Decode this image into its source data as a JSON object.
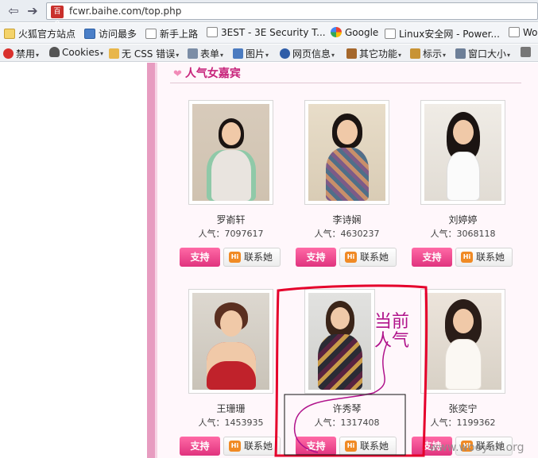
{
  "browser": {
    "url": "fcwr.baihe.com/top.php",
    "site_icon_text": "百合"
  },
  "bookmarks": [
    {
      "label": "火狐官方站点",
      "icon": "folder-icon"
    },
    {
      "label": "访问最多",
      "icon": "star-page-icon"
    },
    {
      "label": "新手上路",
      "icon": "page-icon"
    },
    {
      "label": "3EST - 3E Security T...",
      "icon": "page-icon"
    },
    {
      "label": "Google",
      "icon": "google-icon"
    },
    {
      "label": "Linux安全网 - Power...",
      "icon": "page-icon"
    },
    {
      "label": "Wo",
      "icon": "page-icon"
    }
  ],
  "devbar": [
    {
      "label": "禁用",
      "icon": "disable-icon"
    },
    {
      "label": "Cookies",
      "icon": "person-icon"
    },
    {
      "label": "无 CSS 错误",
      "icon": "pencil-icon"
    },
    {
      "label": "表单",
      "icon": "form-icon"
    },
    {
      "label": "图片",
      "icon": "image-icon"
    },
    {
      "label": "网页信息",
      "icon": "info-icon"
    },
    {
      "label": "其它功能",
      "icon": "toolbox-icon"
    },
    {
      "label": "标示",
      "icon": "marker-icon"
    },
    {
      "label": "窗口大小",
      "icon": "resize-icon"
    }
  ],
  "section": {
    "title": "人气女嘉宾"
  },
  "cards": [
    {
      "name": "罗嵛轩",
      "popularity": "人气：7097617"
    },
    {
      "name": "李诗娴",
      "popularity": "人气：4630237"
    },
    {
      "name": "刘婷婷",
      "popularity": "人气：3068118"
    },
    {
      "name": "王珊珊",
      "popularity": "人气：1453935"
    },
    {
      "name": "许秀琴",
      "popularity": "人气：1317408"
    },
    {
      "name": "张奕宁",
      "popularity": "人气：1199362"
    }
  ],
  "buttons": {
    "support": "支持",
    "contact": "联系她",
    "hi": "Hi"
  },
  "annotation": {
    "line1": "当前",
    "line2": "人气"
  },
  "watermark": "www.wooyun.org",
  "colors": {
    "accent": "#c7247b",
    "annotation": "#e5002b",
    "strip": "#e79cc0"
  }
}
